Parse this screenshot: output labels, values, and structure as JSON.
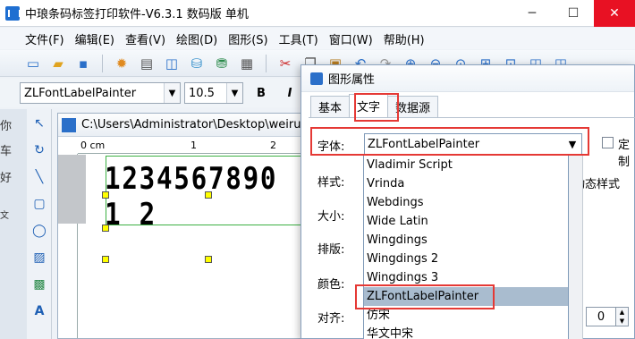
{
  "app": {
    "title": "中琅条码标签打印软件-V6.3.1 数码版 单机",
    "minimize": "─",
    "restore": "☐",
    "close": "✕"
  },
  "menu": [
    "文件(F)",
    "编辑(E)",
    "查看(V)",
    "绘图(D)",
    "图形(S)",
    "工具(T)",
    "窗口(W)",
    "帮助(H)"
  ],
  "toolbar": {
    "font_name": "ZLFontLabelPainter",
    "font_size": "10.5",
    "bold": "B",
    "italic": "I"
  },
  "left_gutter_text": [
    "你",
    "车",
    "好",
    "文"
  ],
  "document": {
    "path": "C:\\Users\\Administrator\\Desktop\\weiruar",
    "ruler_unit": "0 cm",
    "ruler_ticks": [
      "1",
      "2"
    ],
    "barcode_text": "1234567890 1 2"
  },
  "dialog": {
    "title": "图形属性",
    "tabs": [
      "基本",
      "文字",
      "数据源"
    ],
    "labels": {
      "font": "字体:",
      "style": "样式:",
      "size": "大小:",
      "layout": "排版:",
      "color": "颜色:",
      "align": "对齐:"
    },
    "selected_font": "ZLFontLabelPainter",
    "checkbox_label": "定制",
    "dynamic_style_label": "动态样式",
    "spinner_value": "0",
    "font_options": [
      "Vladimir Script",
      "Vrinda",
      "Webdings",
      "Wide Latin",
      "Wingdings",
      "Wingdings 2",
      "Wingdings 3",
      "ZLFontLabelPainter",
      "仿宋",
      "华文中宋"
    ],
    "selected_index": 7
  },
  "colors": {
    "highlight": "#e53935",
    "selection_box": "#3cb043",
    "handle": "#ffff00",
    "selected_item": "#a9bccf"
  }
}
